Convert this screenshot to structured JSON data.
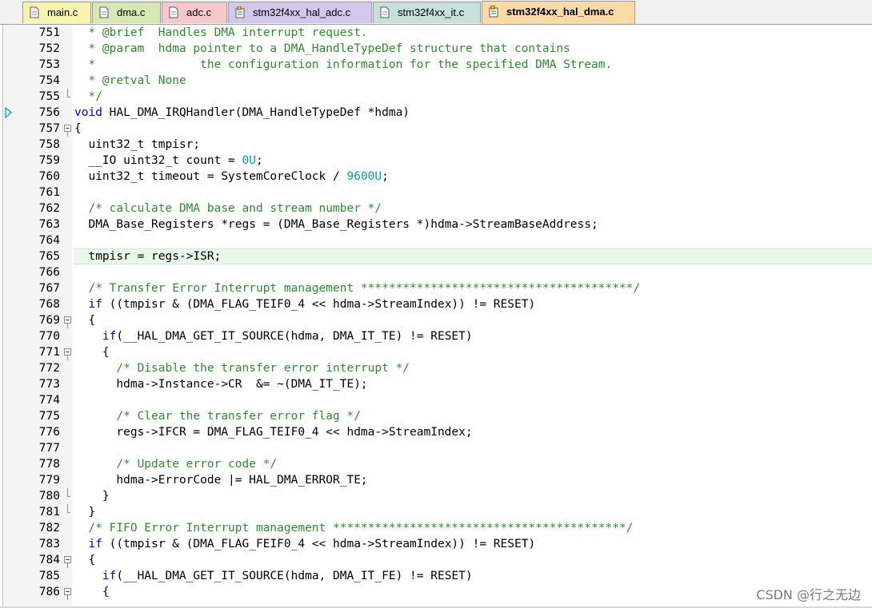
{
  "tabs": [
    {
      "label": "main.c",
      "icon": "file-icon",
      "color": "#f7f4b0"
    },
    {
      "label": "dma.c",
      "icon": "file-icon",
      "color": "#d6e9b5"
    },
    {
      "label": "adc.c",
      "icon": "file-icon",
      "color": "#f6c8cc"
    },
    {
      "label": "stm32f4xx_hal_adc.c",
      "icon": "pinned-file-icon",
      "color": "#d4c7ee"
    },
    {
      "label": "stm32f4xx_it.c",
      "icon": "file-icon",
      "color": "#c6e0da"
    },
    {
      "label": "stm32f4xx_hal_dma.c",
      "icon": "pinned-file-icon",
      "color": "#fbd9a8",
      "active": true
    }
  ],
  "editor": {
    "current_line": "765",
    "lines": [
      {
        "n": "751",
        "fold": "",
        "segs": [
          {
            "t": "  * @brief  Handles DMA interrupt request.",
            "c": "cm"
          }
        ]
      },
      {
        "n": "752",
        "fold": "",
        "segs": [
          {
            "t": "  * @param  hdma pointer to a DMA_HandleTypeDef structure that contains",
            "c": "cm"
          }
        ]
      },
      {
        "n": "753",
        "fold": "",
        "segs": [
          {
            "t": "  *               the configuration information for the specified DMA Stream.",
            "c": "cm"
          }
        ]
      },
      {
        "n": "754",
        "fold": "",
        "segs": [
          {
            "t": "  * @retval None",
            "c": "cm"
          }
        ]
      },
      {
        "n": "755",
        "fold": "end",
        "segs": [
          {
            "t": "  */",
            "c": "cm"
          }
        ]
      },
      {
        "n": "756",
        "fold": "",
        "segs": [
          {
            "t": "void",
            "c": "kw"
          },
          {
            "t": " HAL_DMA_IRQHandler(DMA_HandleTypeDef *hdma)",
            "c": ""
          }
        ]
      },
      {
        "n": "757",
        "fold": "open",
        "segs": [
          {
            "t": "{",
            "c": ""
          }
        ]
      },
      {
        "n": "758",
        "fold": "",
        "segs": [
          {
            "t": "  uint32_t tmpisr;",
            "c": ""
          }
        ]
      },
      {
        "n": "759",
        "fold": "",
        "segs": [
          {
            "t": "  __IO uint32_t count = ",
            "c": ""
          },
          {
            "t": "0U",
            "c": "nm"
          },
          {
            "t": ";",
            "c": ""
          }
        ]
      },
      {
        "n": "760",
        "fold": "",
        "segs": [
          {
            "t": "  uint32_t timeout = SystemCoreClock / ",
            "c": ""
          },
          {
            "t": "9600U",
            "c": "nm"
          },
          {
            "t": ";",
            "c": ""
          }
        ]
      },
      {
        "n": "761",
        "fold": "",
        "segs": []
      },
      {
        "n": "762",
        "fold": "",
        "segs": [
          {
            "t": "  /* calculate DMA base and stream number */",
            "c": "cm"
          }
        ]
      },
      {
        "n": "763",
        "fold": "",
        "segs": [
          {
            "t": "  DMA_Base_Registers *regs = (DMA_Base_Registers *)hdma->StreamBaseAddress;",
            "c": ""
          }
        ]
      },
      {
        "n": "764",
        "fold": "",
        "segs": []
      },
      {
        "n": "765",
        "fold": "",
        "segs": [
          {
            "t": "  tmpisr = regs->ISR;",
            "c": ""
          }
        ]
      },
      {
        "n": "766",
        "fold": "",
        "segs": []
      },
      {
        "n": "767",
        "fold": "",
        "segs": [
          {
            "t": "  /* Transfer Error Interrupt management ***************************************/",
            "c": "cm"
          }
        ]
      },
      {
        "n": "768",
        "fold": "",
        "segs": [
          {
            "t": "  ",
            "c": ""
          },
          {
            "t": "if",
            "c": "kw"
          },
          {
            "t": " ((tmpisr & (DMA_FLAG_TEIF0_4 << hdma->StreamIndex)) != RESET)",
            "c": ""
          }
        ]
      },
      {
        "n": "769",
        "fold": "open",
        "segs": [
          {
            "t": "  {",
            "c": ""
          }
        ]
      },
      {
        "n": "770",
        "fold": "",
        "segs": [
          {
            "t": "    ",
            "c": ""
          },
          {
            "t": "if",
            "c": "kw"
          },
          {
            "t": "(__HAL_DMA_GET_IT_SOURCE(hdma, DMA_IT_TE) != RESET)",
            "c": ""
          }
        ]
      },
      {
        "n": "771",
        "fold": "open",
        "segs": [
          {
            "t": "    {",
            "c": ""
          }
        ]
      },
      {
        "n": "772",
        "fold": "",
        "segs": [
          {
            "t": "      /* Disable the transfer error interrupt */",
            "c": "cm"
          }
        ]
      },
      {
        "n": "773",
        "fold": "",
        "segs": [
          {
            "t": "      hdma->Instance->CR  &= ~(DMA_IT_TE);",
            "c": ""
          }
        ]
      },
      {
        "n": "774",
        "fold": "",
        "segs": []
      },
      {
        "n": "775",
        "fold": "",
        "segs": [
          {
            "t": "      /* Clear the transfer error flag */",
            "c": "cm"
          }
        ]
      },
      {
        "n": "776",
        "fold": "",
        "segs": [
          {
            "t": "      regs->IFCR = DMA_FLAG_TEIF0_4 << hdma->StreamIndex;",
            "c": ""
          }
        ]
      },
      {
        "n": "777",
        "fold": "",
        "segs": []
      },
      {
        "n": "778",
        "fold": "",
        "segs": [
          {
            "t": "      /* Update error code */",
            "c": "cm"
          }
        ]
      },
      {
        "n": "779",
        "fold": "",
        "segs": [
          {
            "t": "      hdma->ErrorCode |= HAL_DMA_ERROR_TE;",
            "c": ""
          }
        ]
      },
      {
        "n": "780",
        "fold": "end",
        "segs": [
          {
            "t": "    }",
            "c": ""
          }
        ]
      },
      {
        "n": "781",
        "fold": "end",
        "segs": [
          {
            "t": "  }",
            "c": ""
          }
        ]
      },
      {
        "n": "782",
        "fold": "",
        "segs": [
          {
            "t": "  /* FIFO Error Interrupt management ******************************************/",
            "c": "cm"
          }
        ]
      },
      {
        "n": "783",
        "fold": "",
        "segs": [
          {
            "t": "  ",
            "c": ""
          },
          {
            "t": "if",
            "c": "kw"
          },
          {
            "t": " ((tmpisr & (DMA_FLAG_FEIF0_4 << hdma->StreamIndex)) != RESET)",
            "c": ""
          }
        ]
      },
      {
        "n": "784",
        "fold": "open",
        "segs": [
          {
            "t": "  {",
            "c": ""
          }
        ]
      },
      {
        "n": "785",
        "fold": "",
        "segs": [
          {
            "t": "    ",
            "c": ""
          },
          {
            "t": "if",
            "c": "kw"
          },
          {
            "t": "(__HAL_DMA_GET_IT_SOURCE(hdma, DMA_IT_FE) != RESET)",
            "c": ""
          }
        ]
      },
      {
        "n": "786",
        "fold": "open",
        "segs": [
          {
            "t": "    {",
            "c": ""
          }
        ]
      }
    ]
  },
  "watermark": "CSDN @行之无边",
  "colors": {
    "comment": "#2e8b2e",
    "keyword": "#0000d0",
    "number": "#00a0a0",
    "current_line": "#e8f8ea"
  }
}
